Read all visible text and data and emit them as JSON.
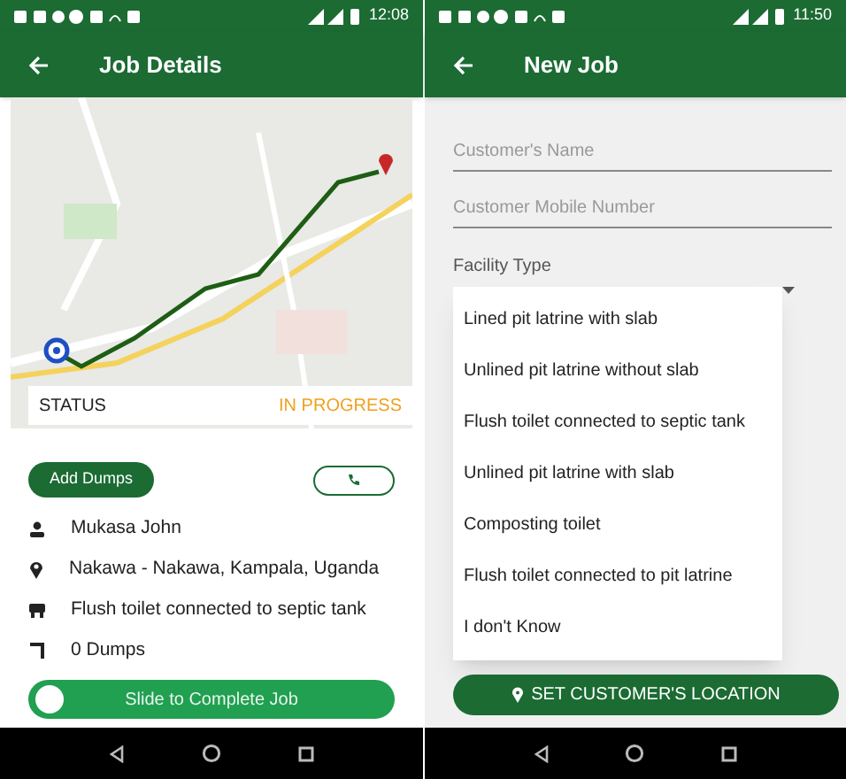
{
  "screens": [
    {
      "status_bar": {
        "time": "12:08"
      },
      "app_bar": {
        "title": "Job Details"
      },
      "status": {
        "label": "STATUS",
        "value": "IN PROGRESS"
      },
      "add_button": "Add Dumps",
      "details": [
        {
          "kind": "person",
          "text": "Mukasa John"
        },
        {
          "kind": "location",
          "text": "Nakawa - Nakawa, Kampala, Uganda"
        },
        {
          "kind": "facility",
          "text": "Flush toilet connected to septic tank"
        },
        {
          "kind": "dumps",
          "text": "0 Dumps"
        }
      ],
      "slider": {
        "label": "Slide to Complete Job",
        "level": 0
      }
    },
    {
      "status_bar": {
        "time": "11:50"
      },
      "app_bar": {
        "title": "New Job"
      },
      "fields": [
        {
          "placeholder": "Customer's Name"
        },
        {
          "placeholder": "Customer Mobile Number"
        }
      ],
      "facility": {
        "label": "Facility Type",
        "expanded": true,
        "options": [
          "Lined pit latrine with slab",
          "Unlined pit latrine without slab",
          "Flush toilet connected to septic tank",
          "Unlined pit latrine with slab",
          "Composting toilet",
          "Flush toilet connected to pit latrine",
          "I don't Know"
        ]
      },
      "location_button": "SET CUSTOMER'S LOCATION"
    }
  ]
}
